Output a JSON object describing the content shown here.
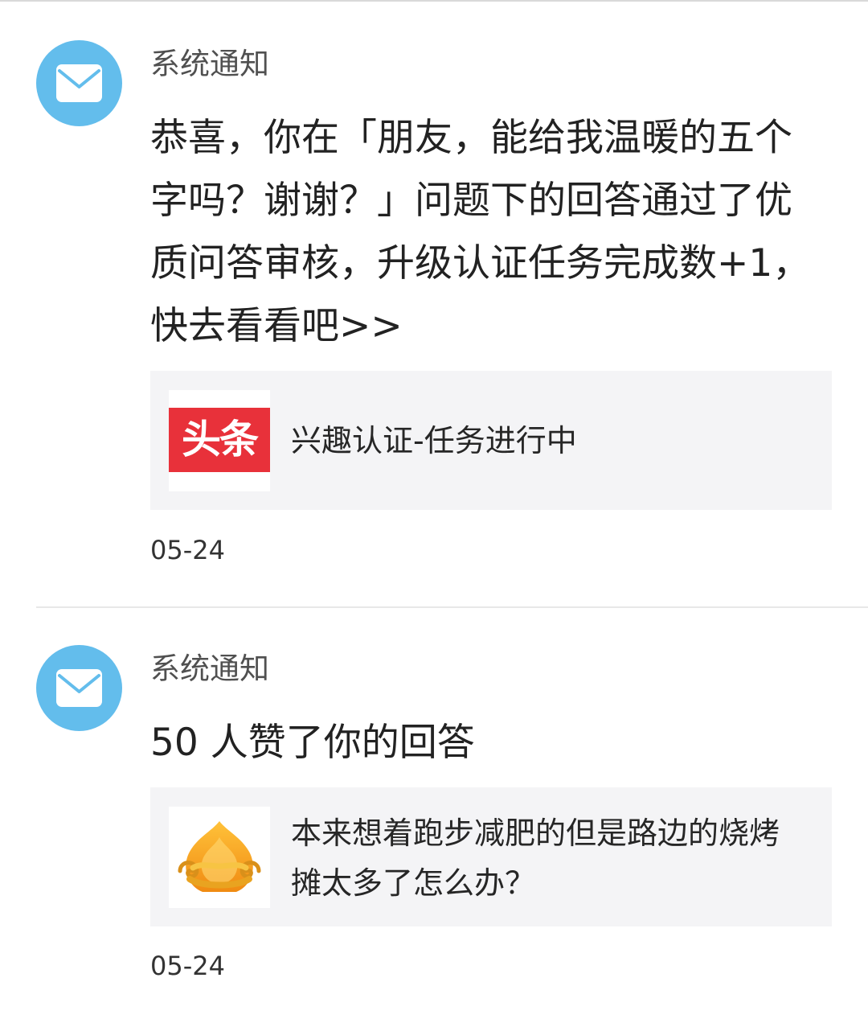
{
  "notifications": [
    {
      "sender": "系统通知",
      "avatar_icon": "envelope-icon",
      "message": "恭喜，你在「朋友，能给我温暖的五个字吗？谢谢？」问题下的回答通过了优质问答审核，升级认证任务完成数+1，快去看看吧>>",
      "card": {
        "thumb_icon": "toutiao-logo",
        "thumb_text": "头条",
        "text": "兴趣认证-任务进行中"
      },
      "date": "05-24"
    },
    {
      "sender": "系统通知",
      "avatar_icon": "envelope-icon",
      "message": "50 人赞了你的回答",
      "card": {
        "thumb_icon": "golden-cloud-logo",
        "text": "本来想着跑步减肥的但是路边的烧烤摊太多了怎么办？"
      },
      "date": "05-24"
    }
  ],
  "colors": {
    "avatar_bg": "#63bdec",
    "toutiao_red": "#e8313a",
    "card_bg": "#f4f4f6"
  }
}
